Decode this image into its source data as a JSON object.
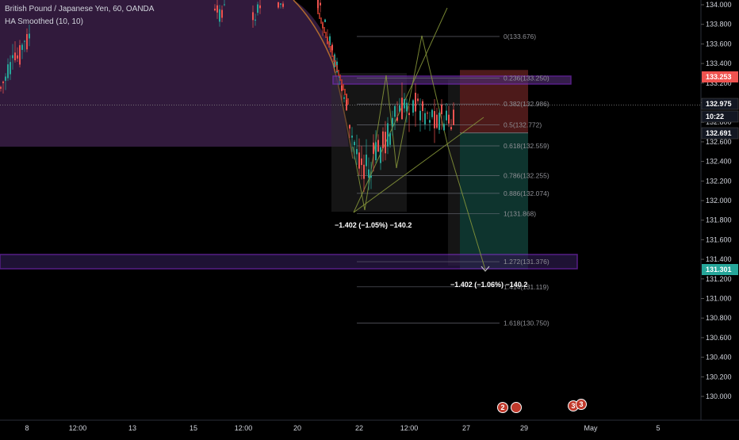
{
  "header": {
    "title": "British Pound / Japanese Yen, 60, OANDA",
    "indicator": "HA Smoothed (10, 10)"
  },
  "colors": {
    "background": "#000000",
    "up": "#26a69a",
    "down": "#ef5350",
    "purple": "#7b2cbf",
    "fib": "#787b86",
    "trendline": "#8a9a3b",
    "price_red": "#ef5350",
    "price_green": "#26a69a"
  },
  "chart_data": {
    "type": "candlestick",
    "symbol": "British Pound / Japanese Yen",
    "interval": "60",
    "source": "OANDA",
    "y_axis": {
      "ticks": [
        "134.000",
        "133.800",
        "133.600",
        "133.400",
        "133.200",
        "133.000",
        "132.800",
        "132.600",
        "132.400",
        "132.200",
        "132.000",
        "131.800",
        "131.600",
        "131.400",
        "131.200",
        "131.000",
        "130.800",
        "130.600",
        "130.400",
        "130.200",
        "130.000"
      ],
      "range": [
        129.85,
        134.05
      ]
    },
    "x_axis": {
      "ticks": [
        "8",
        "12:00",
        "13",
        "15",
        "12:00",
        "20",
        "22",
        "12:00",
        "27",
        "29",
        "May",
        "5"
      ]
    },
    "price_labels": [
      {
        "name": "current-price",
        "value": "133.253",
        "color": "red"
      },
      {
        "name": "last-price",
        "value": "132.975",
        "color": "dark"
      },
      {
        "name": "countdown",
        "value": "10:22",
        "color": "dark"
      },
      {
        "name": "entry-price",
        "value": "132.691",
        "color": "dark"
      },
      {
        "name": "target-price",
        "value": "131.301",
        "color": "green"
      }
    ],
    "fib_levels": [
      {
        "label": "0(133.676)",
        "value": 133.676
      },
      {
        "label": "0.236(133.250)",
        "value": 133.25
      },
      {
        "label": "0.382(132.986)",
        "value": 132.986
      },
      {
        "label": "0.5(132.772)",
        "value": 132.772
      },
      {
        "label": "0.618(132.559)",
        "value": 132.559
      },
      {
        "label": "0.786(132.255)",
        "value": 132.255
      },
      {
        "label": "0.886(132.074)",
        "value": 132.074
      },
      {
        "label": "1(131.868)",
        "value": 131.868
      },
      {
        "label": "1.272(131.376)",
        "value": 131.376
      },
      {
        "label": "1.414(131.119)",
        "value": 131.119
      },
      {
        "label": "1.618(130.750)",
        "value": 130.75
      }
    ],
    "measurements": [
      {
        "label": "−1.402 (−1.05%) −140.2"
      },
      {
        "label": "−1.402 (−1.06%) −140.2"
      }
    ],
    "zones": [
      {
        "name": "resistance-zone",
        "low": 133.17,
        "high": 133.25
      },
      {
        "name": "support-zone",
        "low": 131.3,
        "high": 131.44
      }
    ],
    "position": {
      "type": "short",
      "entry": 132.691,
      "stop": 133.253,
      "target": 131.301
    },
    "events": [
      {
        "name": "event-badge-1",
        "count": "2"
      },
      {
        "name": "event-badge-2",
        "count": ""
      },
      {
        "name": "event-badge-3",
        "count": "3"
      }
    ]
  }
}
